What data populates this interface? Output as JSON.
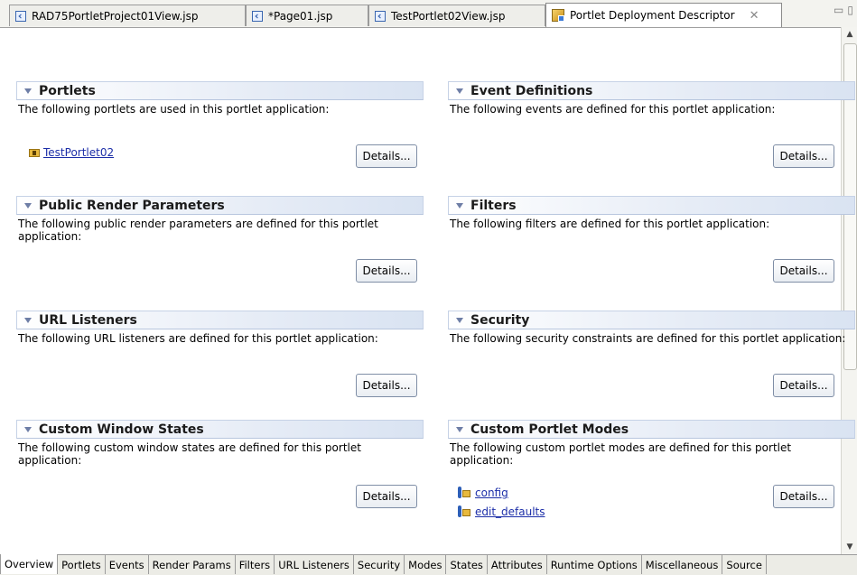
{
  "editor_tabs": [
    {
      "label": "RAD75PortletProject01View.jsp",
      "icon": "jsp-file-icon"
    },
    {
      "label": "*Page01.jsp",
      "icon": "jsp-file-icon"
    },
    {
      "label": "TestPortlet02View.jsp",
      "icon": "jsp-file-icon"
    },
    {
      "label": "Portlet Deployment Descriptor",
      "icon": "portlet-descriptor-icon",
      "active": true
    }
  ],
  "details_label": "Details...",
  "sections": {
    "portlets": {
      "title": "Portlets",
      "description": "The following portlets are used in this portlet application:",
      "items": [
        "TestPortlet02"
      ]
    },
    "event_definitions": {
      "title": "Event Definitions",
      "description": "The following events are defined for this portlet application:"
    },
    "public_render_parameters": {
      "title": "Public Render Parameters",
      "description": "The following public render parameters are defined for this portlet application:"
    },
    "filters": {
      "title": "Filters",
      "description": "The following filters are defined for this portlet application:"
    },
    "url_listeners": {
      "title": "URL Listeners",
      "description": "The following URL listeners are defined for this portlet application:"
    },
    "security": {
      "title": "Security",
      "description": "The following security constraints are defined for this portlet application:"
    },
    "custom_window_states": {
      "title": "Custom Window States",
      "description": "The following custom window states are defined for this portlet application:"
    },
    "custom_portlet_modes": {
      "title": "Custom Portlet Modes",
      "description": "The following custom portlet modes are defined for this portlet application:",
      "items": [
        "config",
        "edit_defaults"
      ]
    }
  },
  "page_tabs": [
    "Overview",
    "Portlets",
    "Events",
    "Render Params",
    "Filters",
    "URL Listeners",
    "Security",
    "Modes",
    "States",
    "Attributes",
    "Runtime Options",
    "Miscellaneous",
    "Source"
  ],
  "active_page_tab": "Overview",
  "colors": {
    "section_header_gradient": "#d9e3f2",
    "link": "#1c2ea8"
  }
}
